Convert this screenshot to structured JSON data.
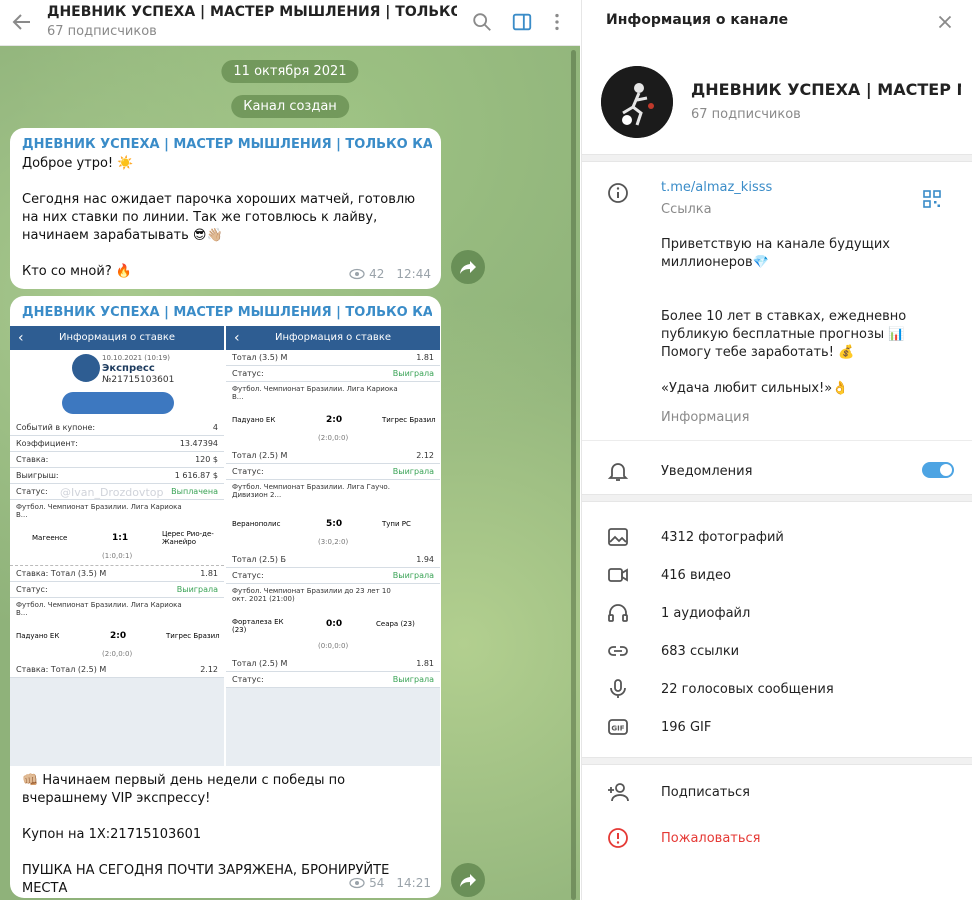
{
  "chat": {
    "title": "ДНЕВНИК УСПЕХА | МАСТЕР МЫШЛЕНИЯ | ТОЛЬКО КАЧЕСТВЕ...",
    "subscribers": "67 подписчиков",
    "date_pill": "11 октября 2021",
    "service_pill": "Канал создан",
    "messages": [
      {
        "author": "ДНЕВНИК УСПЕХА | МАСТЕР МЫШЛЕНИЯ | ТОЛЬКО КАЧЕСТВЕ...",
        "text": "Доброе утро! ☀️\n\nСегодня нас ожидает парочка хороших матчей, готовлю на них ставки по линии. Так же готовлюсь к лайву, начинаем зарабатывать 😎👋🏼\n\nКто со мной? 🔥",
        "views": "42",
        "time": "12:44"
      },
      {
        "author": "ДНЕВНИК УСПЕХА | МАСТЕР МЫШЛЕНИЯ | ТОЛЬКО КАЧЕСТВЕ...",
        "text": "👊🏼 Начинаем первый день недели с победы по вчерашнему VIP экспрессу!\n\nКупон на 1X:21715103601\n\nПУШКА НА СЕГОДНЯ ПОЧТИ ЗАРЯЖЕНА, БРОНИРУЙТЕ МЕСТА",
        "views": "54",
        "time": "14:21"
      }
    ],
    "shot": {
      "left_title": "Информация о ставке",
      "right_title": "Информация о ставке",
      "coupon_date": "10.10.2021 (10:19)",
      "coupon_type": "Экспресс",
      "coupon_no": "№21715103601",
      "watermark": "@Ivan_Drozdovtop",
      "left_rows": [
        {
          "k": "Событий в купоне:",
          "v": "4"
        },
        {
          "k": "Коэффициент:",
          "v": "13.47394"
        },
        {
          "k": "Ставка:",
          "v": "120 $"
        },
        {
          "k": "Выигрыш:",
          "v": "1 616.87 $"
        },
        {
          "k": "Статус:",
          "v": "Выплачена"
        }
      ],
      "left_matches": [
        {
          "league": "Футбол. Чемпионат Бразилии. Лига Кариока В...",
          "home": "Магеенсе",
          "score": "1:1",
          "away": "Церес Рио-де-Жанейро",
          "half": "(1:0,0:1)",
          "bet": "Тотал (3.5) М",
          "odd": "1.81",
          "status": "Выиграла"
        },
        {
          "league": "Футбол. Чемпионат Бразилии. Лига Кариока В...",
          "home": "Падуано ЕК",
          "score": "2:0",
          "away": "Тигрес Бразил",
          "half": "(2:0,0:0)",
          "bet": "Тотал (2.5) М",
          "odd": "2.12",
          "status": ""
        }
      ],
      "right_matches": [
        {
          "league": "Футбол. Чемпионат Бразилии. Лига Кариока В...",
          "home": "Падуано ЕК",
          "score": "2:0",
          "away": "Тигрес Бразил",
          "half": "(2:0,0:0)",
          "bet": "Тотал (2.5) М",
          "odd": "2.12",
          "status": "Выиграла"
        },
        {
          "league": "Футбол. Чемпионат Бразилии. Лига Гаучо. Дивизион 2...",
          "home": "Веранополис",
          "score": "5:0",
          "away": "Тупи РС",
          "half": "(3:0,2:0)",
          "bet": "Тотал (2.5) Б",
          "odd": "1.94",
          "status": "Выиграла"
        },
        {
          "league": "Футбол. Чемпионат Бразилии до 23 лет 10 окт. 2021 (21:00)",
          "home": "Форталеза ЕК (23)",
          "score": "0:0",
          "away": "Сеара (23)",
          "half": "(0:0,0:0)",
          "bet": "Тотал (2.5) М",
          "odd": "1.81",
          "status": "Выиграла"
        }
      ],
      "right_top_row": {
        "k": "Тотал (3.5) М",
        "v": "1.81",
        "status_k": "Статус:",
        "status_v": "Выиграла"
      },
      "status_label": "Статус:",
      "bet_label": "Ставка:"
    }
  },
  "info": {
    "header": "Информация о канале",
    "name": "ДНЕВНИК УСПЕХА | МАСТЕР М...",
    "subscribers": "67 подписчиков",
    "link": "t.me/almaz_kisss",
    "link_label": "Ссылка",
    "description": "Приветствую на канале будущих миллионеров💎\n\n\nБолее 10 лет в ставках, ежедневно публикую бесплатные прогнозы 📊\nПомогу тебе заработать! 💰\n\n«Удача любит сильных!»👌",
    "description_label": "Информация",
    "notifications": "Уведомления",
    "notifications_on": true,
    "media": [
      {
        "icon": "photo-icon",
        "label": "4312 фотографий"
      },
      {
        "icon": "video-icon",
        "label": "416 видео"
      },
      {
        "icon": "headphones-icon",
        "label": "1 аудиофайл"
      },
      {
        "icon": "link-icon",
        "label": "683 ссылки"
      },
      {
        "icon": "microphone-icon",
        "label": "22 голосовых сообщения"
      },
      {
        "icon": "gif-icon",
        "label": "196 GIF"
      }
    ],
    "subscribe": "Подписаться",
    "report": "Пожаловаться",
    "accent": "#3a8cc8",
    "danger": "#e53935"
  }
}
